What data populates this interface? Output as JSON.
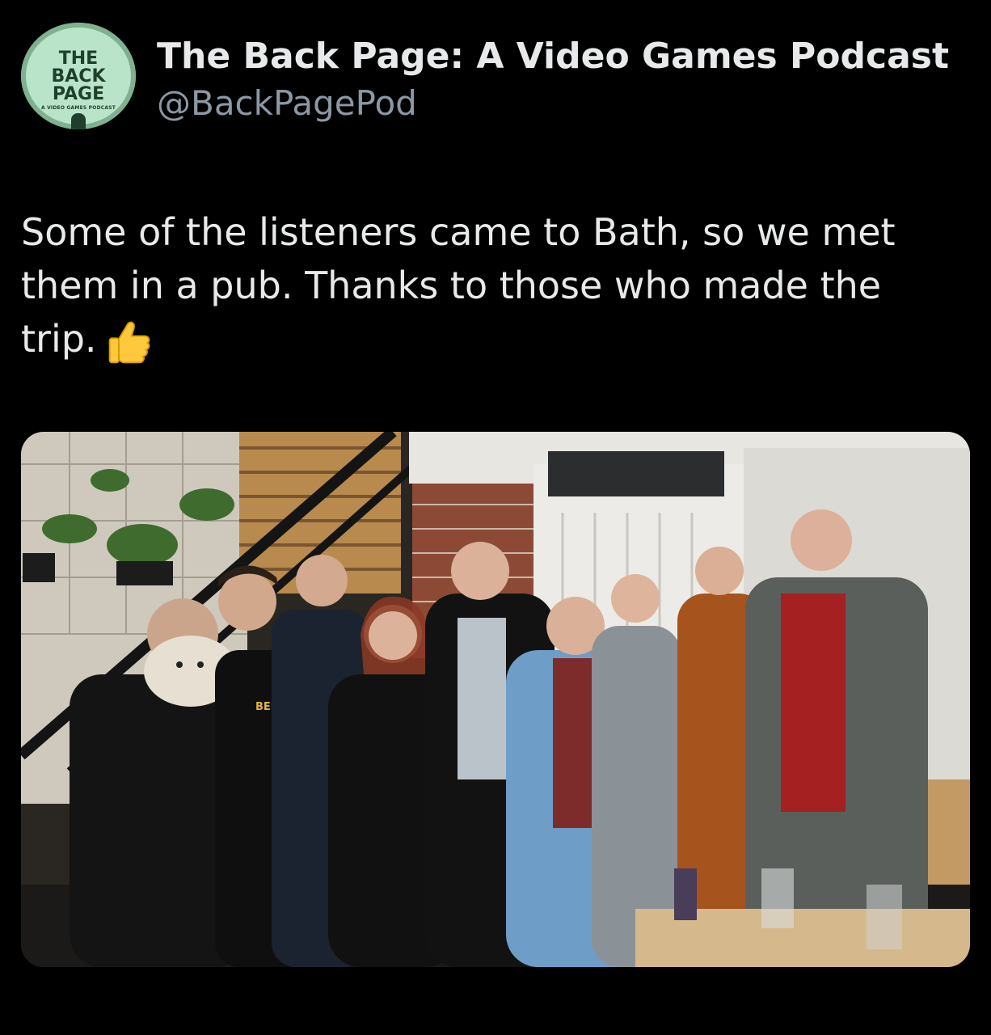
{
  "account": {
    "display_name": "The Back Page: A Video Games Podcast",
    "handle": "@BackPagePod",
    "avatar": {
      "line1": "THE",
      "line2": "BACK",
      "line3": "PAGE",
      "line4": "A VIDEO GAMES PODCAST"
    }
  },
  "tweet": {
    "text": "Some of the listeners came to Bath, so we met them in a pub. Thanks to those who made the trip.",
    "emoji": "thumbs-up-icon"
  },
  "photo": {
    "shirt_print": "BEER RIFF"
  },
  "colors": {
    "background": "#000000",
    "text_primary": "#e7e9ea",
    "text_secondary": "#8b98a5"
  }
}
